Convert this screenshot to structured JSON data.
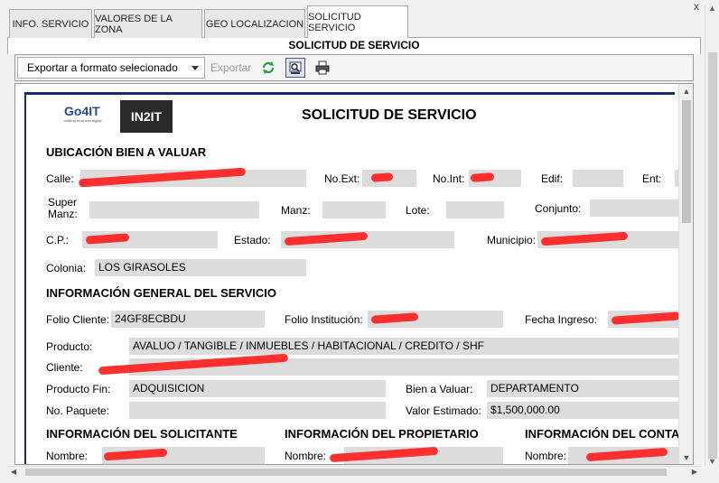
{
  "tabs": [
    {
      "label": "INFO. SERVICIO"
    },
    {
      "label": "VALORES DE LA ZONA"
    },
    {
      "label": "GEO LOCALIZACION"
    },
    {
      "label": "SOLICITUD SERVICIO"
    }
  ],
  "close_label": "x",
  "panel_title": "SOLICITUD DE SERVICIO",
  "toolbar": {
    "export_dropdown": "Exportar a formato selecionado",
    "export_button": "Exportar",
    "icons": [
      "refresh-icon",
      "zoom-icon",
      "print-icon"
    ]
  },
  "doc": {
    "logo_go4it": "Go4IT",
    "logo_go4it_sub": "making business digital",
    "logo_in2it": "IN2IT",
    "title": "SOLICITUD DE SERVICIO",
    "sec_ubicacion": "UBICACIÓN BIEN A VALUAR",
    "calle_lbl": "Calle:",
    "noext_lbl": "No.Ext:",
    "noint_lbl": "No.Int:",
    "edif_lbl": "Edif:",
    "ent_lbl": "Ent:",
    "supermanz_lbl1": "Super",
    "supermanz_lbl2": "Manz:",
    "manz_lbl": "Manz:",
    "lote_lbl": "Lote:",
    "conjunto_lbl": "Conjunto:",
    "cp_lbl": "C.P.:",
    "estado_lbl": "Estado:",
    "municipio_lbl": "Municipio:",
    "colonia_lbl": "Colonia:",
    "colonia_val": "LOS GIRASOLES",
    "sec_general": "INFORMACIÓN GENERAL DEL SERVICIO",
    "folio_cliente_lbl": "Folio Cliente:",
    "folio_cliente_val": "24GF8ECBDU",
    "folio_inst_lbl": "Folio Institución:",
    "fecha_ingreso_lbl": "Fecha Ingreso:",
    "producto_lbl": "Producto:",
    "producto_val": "AVALUO / TANGIBLE / INMUEBLES / HABITACIONAL / CREDITO / SHF",
    "cliente_lbl": "Cliente:",
    "producto_fin_lbl": "Producto Fin:",
    "producto_fin_val": "ADQUISICION",
    "bien_valuar_lbl": "Bien a Valuar:",
    "bien_valuar_val": "DEPARTAMENTO",
    "no_paquete_lbl": "No. Paquete:",
    "valor_estimado_lbl": "Valor Estimado:",
    "valor_estimado_val": "$1,500,000.00",
    "sec_solicitante": "INFORMACIÓN DEL SOLICITANTE",
    "sec_propietario": "INFORMACIÓN DEL PROPIETARIO",
    "sec_contacto": "INFORMACIÓN DEL CONTAC",
    "nombre_lbl": "Nombre:"
  },
  "accent_colors": {
    "doc_border": "#1a2a6a",
    "redaction": "#ff2020",
    "field_bg": "#dcdcdc"
  }
}
